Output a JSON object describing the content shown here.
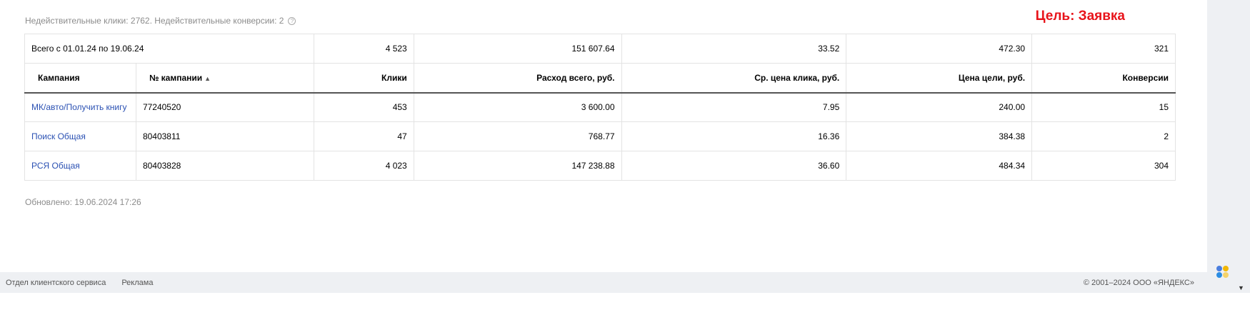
{
  "invalid_info": "Недействительные клики: 2762. Недействительные конверсии: 2",
  "help_glyph": "?",
  "goal": "Цель: Заявка",
  "total_row": {
    "label": "Всего с 01.01.24 по 19.06.24",
    "clicks": "4 523",
    "spend": "151 607.64",
    "avg_cpc": "33.52",
    "cpa": "472.30",
    "conversions": "321"
  },
  "columns": {
    "campaign": "Кампания",
    "campaign_id": "№ кампании",
    "sort_indicator": "▲",
    "clicks": "Клики",
    "spend": "Расход всего, руб.",
    "avg_cpc": "Ср. цена клика, руб.",
    "cpa": "Цена цели, руб.",
    "conversions": "Конверсии"
  },
  "rows": [
    {
      "name": "МК/авто/Получить книгу",
      "id": "77240520",
      "clicks": "453",
      "spend": "3 600.00",
      "avg_cpc": "7.95",
      "cpa": "240.00",
      "conversions": "15"
    },
    {
      "name": "Поиск Общая",
      "id": "80403811",
      "clicks": "47",
      "spend": "768.77",
      "avg_cpc": "16.36",
      "cpa": "384.38",
      "conversions": "2"
    },
    {
      "name": "РСЯ Общая",
      "id": "80403828",
      "clicks": "4 023",
      "spend": "147 238.88",
      "avg_cpc": "36.60",
      "cpa": "484.34",
      "conversions": "304"
    }
  ],
  "updated": "Обновлено: 19.06.2024 17:26",
  "footer": {
    "support": "Отдел клиентского сервиса",
    "ads": "Реклама",
    "copyright": "© 2001–2024  ООО «ЯНДЕКС»"
  },
  "scroll_down_glyph": "▼",
  "colors": {
    "goal": "#e8131a",
    "link": "#2b51b3",
    "footer_bg": "#eef0f3"
  }
}
